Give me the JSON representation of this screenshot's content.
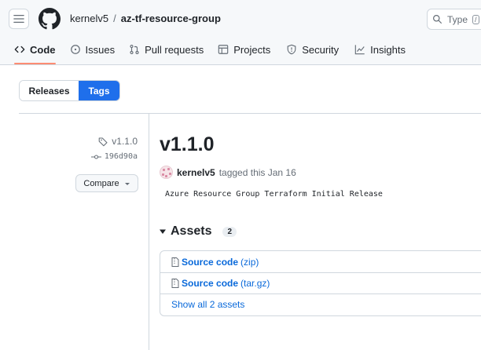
{
  "header": {
    "owner": "kernelv5",
    "separator": "/",
    "repo": "az-tf-resource-group",
    "search_placeholder": "Type",
    "search_kbd": "/"
  },
  "nav": {
    "tabs": [
      {
        "label": "Code",
        "icon": "code-icon",
        "active": true
      },
      {
        "label": "Issues",
        "icon": "issue-icon"
      },
      {
        "label": "Pull requests",
        "icon": "pull-request-icon"
      },
      {
        "label": "Projects",
        "icon": "table-icon"
      },
      {
        "label": "Security",
        "icon": "shield-icon"
      },
      {
        "label": "Insights",
        "icon": "graph-icon"
      }
    ]
  },
  "toggle": {
    "releases": "Releases",
    "tags": "Tags",
    "selected": "Tags"
  },
  "release": {
    "side_tag": "v1.1.0",
    "side_commit": "196d90a",
    "compare_label": "Compare",
    "title": "v1.1.0",
    "author": "kernelv5",
    "action": "tagged this Jan 16",
    "description": "Azure Resource Group Terraform Initial Release"
  },
  "assets": {
    "heading": "Assets",
    "count": "2",
    "items": [
      {
        "name": "Source code",
        "ext": "(zip)"
      },
      {
        "name": "Source code",
        "ext": "(tar.gz)"
      }
    ],
    "show_all": "Show all 2 assets"
  },
  "colors": {
    "accent": "#1f6feb",
    "link": "#0969da",
    "active_tab_underline": "#fd8c73"
  }
}
